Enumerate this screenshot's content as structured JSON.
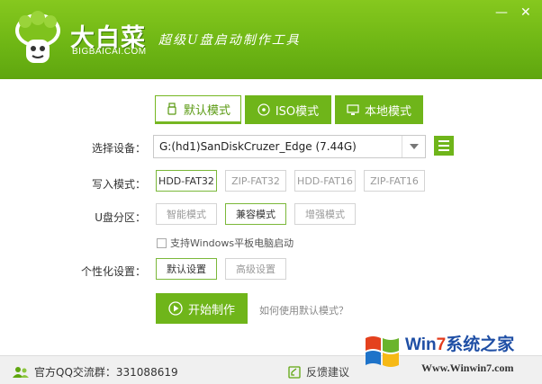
{
  "header": {
    "brand_cn": "大白菜",
    "brand_en": "BIGBAICAI.COM",
    "slogan": "超级U盘启动制作工具",
    "minimize_icon": "minimize-icon",
    "close_icon": "close-icon"
  },
  "tabs": [
    {
      "label": "默认模式",
      "icon": "usb-drive-icon",
      "active": true
    },
    {
      "label": "ISO模式",
      "icon": "disc-icon",
      "active": false
    },
    {
      "label": "本地模式",
      "icon": "monitor-icon",
      "active": false
    }
  ],
  "device": {
    "label": "选择设备：",
    "value": "G:(hd1)SanDiskCruzer_Edge (7.44G)"
  },
  "write_mode": {
    "label": "写入模式：",
    "options": [
      "HDD-FAT32",
      "ZIP-FAT32",
      "HDD-FAT16",
      "ZIP-FAT16"
    ],
    "selected": "HDD-FAT32"
  },
  "partition": {
    "label": "U盘分区：",
    "options": [
      "智能模式",
      "兼容模式",
      "增强模式"
    ],
    "selected": "兼容模式"
  },
  "tablet_checkbox": {
    "label": "支持Windows平板电脑启动",
    "checked": false
  },
  "personalize": {
    "label": "个性化设置：",
    "options": [
      "默认设置",
      "高级设置"
    ],
    "selected": "默认设置"
  },
  "actions": {
    "start_label": "开始制作",
    "help_label": "如何使用默认模式？"
  },
  "footer": {
    "qq_label": "官方QQ交流群：331088619",
    "feedback_label": "反馈建议"
  },
  "watermark": {
    "title_win": "Win",
    "title_seven": "7",
    "title_rest": "系统之家",
    "url": "Www.Winwin7.com"
  },
  "colors": {
    "brand_green": "#6fb51a",
    "header_green": "#86c81e"
  }
}
